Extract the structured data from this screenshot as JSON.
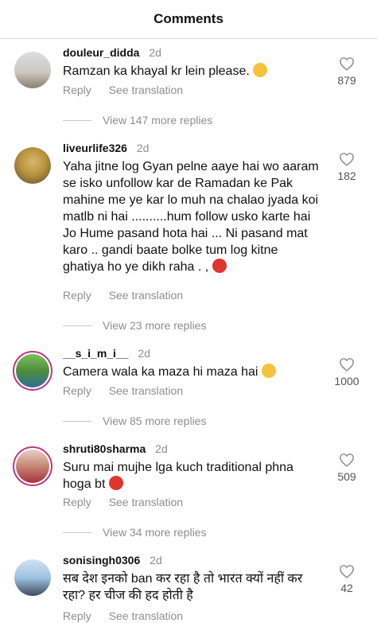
{
  "header": {
    "title": "Comments"
  },
  "actions": {
    "reply": "Reply",
    "see_translation": "See translation"
  },
  "comments": [
    {
      "username": "douleur_didda",
      "time": "2d",
      "text": "Ramzan ka khayal kr lein please.",
      "likes": "879",
      "view_replies": "View 147 more replies"
    },
    {
      "username": "liveurlife326",
      "time": "2d",
      "text": "Yaha jitne log Gyan pelne aaye hai wo aaram se isko unfollow kar de Ramadan ke Pak mahine me ye kar lo muh na chalao jyada koi matlb ni hai ..........hum follow usko karte hai Jo Hume pasand hota hai ... Ni pasand mat karo .. gandi baate bolke tum log kitne ghatiya ho ye dikh raha . ,",
      "likes": "182",
      "view_replies": "View 23 more replies"
    },
    {
      "username": "__s_i_m_i__",
      "time": "2d",
      "text": "Camera wala ka maza hi maza hai",
      "likes": "1000",
      "view_replies": "View 85 more replies"
    },
    {
      "username": "shruti80sharma",
      "time": "2d",
      "text": "Suru mai mujhe lga kuch traditional phna hoga bt",
      "likes": "509",
      "view_replies": "View 34 more replies"
    },
    {
      "username": "sonisingh0306",
      "time": "2d",
      "text": "सब देश इनको ban कर रहा है तो भारत क्यों नहीं कर रहा? हर चीज की हद होती है",
      "likes": "42"
    }
  ],
  "icons": {
    "like": "heart-outline-icon"
  },
  "colors": {
    "secondary_text": "#8e8e8e",
    "story_ring": "#c13584"
  }
}
